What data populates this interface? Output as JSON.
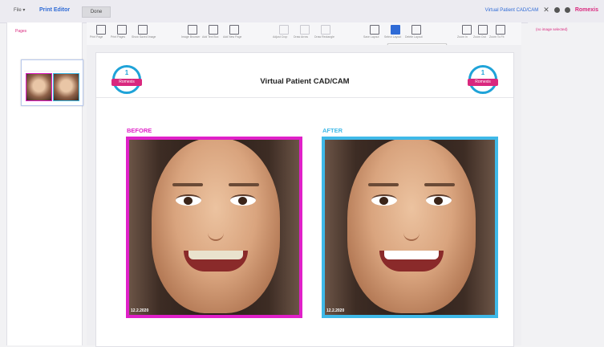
{
  "topbar": {
    "file_label": "File ▾",
    "title": "Print Editor",
    "done_label": "Done",
    "patient_link": "Virtual Patient CAD/CAM",
    "close_glyph": "✕",
    "brand": "Romexis"
  },
  "pages_panel": {
    "title": "Pages"
  },
  "toolbar": {
    "tools": [
      {
        "label": "Print Page",
        "icon": "printer-icon"
      },
      {
        "label": "Print Pages",
        "icon": "printer-multi-icon"
      },
      {
        "label": "Show Saved Image",
        "icon": "export-icon"
      },
      {
        "label": "Image Browser",
        "icon": "image-browser-icon"
      },
      {
        "label": "Add Text Box",
        "icon": "text-box-icon"
      },
      {
        "label": "Add New Page",
        "icon": "add-page-icon"
      },
      {
        "label": "Adjust Crop",
        "icon": "crop-icon"
      },
      {
        "label": "Draw Arrow",
        "icon": "arrow-icon"
      },
      {
        "label": "Draw Rectangle",
        "icon": "rectangle-icon"
      },
      {
        "label": "Save Layout",
        "icon": "save-layout-icon"
      },
      {
        "label": "Select Layout",
        "icon": "select-layout-icon"
      },
      {
        "label": "Delete Layout",
        "icon": "delete-layout-icon"
      },
      {
        "label": "Zoom In",
        "icon": "zoom-in-icon"
      },
      {
        "label": "Zoom Out",
        "icon": "zoom-out-icon"
      },
      {
        "label": "Zoom To Fit",
        "icon": "fit-icon"
      }
    ],
    "tooltip": "Select A Saved Template"
  },
  "document": {
    "title": "Virtual Patient CAD/CAM",
    "logo_number": "1",
    "logo_brand": "Romexis",
    "before_label": "BEFORE",
    "after_label": "AFTER",
    "before_date": "12.2.2020",
    "after_date": "12.2.2020"
  },
  "right_panel": {
    "status": "(no image selected)"
  },
  "colors": {
    "accent_blue": "#2f6bd6",
    "brand_pink": "#d9287e",
    "before_border": "#e020c8",
    "after_border": "#3fb9e8"
  }
}
